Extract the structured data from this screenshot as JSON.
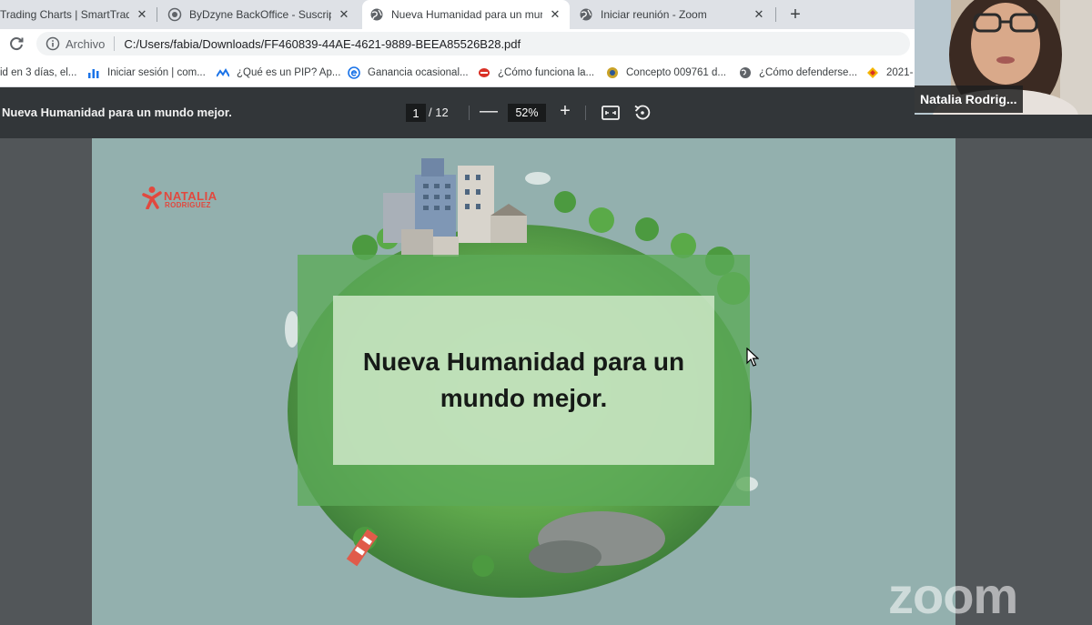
{
  "tabs": [
    {
      "title": "Trading Charts | SmartTrader",
      "icon": "trading-icon",
      "active": false
    },
    {
      "title": "ByDzyne BackOffice - Suscripción",
      "icon": "bydzyne-icon",
      "active": false
    },
    {
      "title": "Nueva Humanidad para un mundo mejor.",
      "icon": "globe-icon",
      "active": true
    },
    {
      "title": "Iniciar reunión - Zoom",
      "icon": "globe-icon",
      "active": false
    }
  ],
  "new_tab_label": "+",
  "close_glyph": "✕",
  "address": {
    "scheme_label": "Archivo",
    "url": "C:/Users/fabia/Downloads/FF460839-44AE-4621-9889-BEEA85526B28.pdf"
  },
  "bookmarks": [
    {
      "label": "id en 3 días, el...",
      "icon": ""
    },
    {
      "label": "Iniciar sesión | com...",
      "icon": "chart-icon"
    },
    {
      "label": "¿Qué es un PIP? Ap...",
      "icon": "mountain-icon"
    },
    {
      "label": "Ganancia ocasional...",
      "icon": "e-icon"
    },
    {
      "label": "¿Cómo funciona la...",
      "icon": "red-icon"
    },
    {
      "label": "Concepto 009761 d...",
      "icon": "seal-icon"
    },
    {
      "label": "¿Cómo defenderse...",
      "icon": "globe-icon"
    },
    {
      "label": "2021-",
      "icon": "diamond-icon"
    }
  ],
  "pdf": {
    "title": "Nueva Humanidad para un mundo mejor.",
    "current_page": "1",
    "total_pages": "/ 12",
    "zoom_minus": "—",
    "zoom": "52%",
    "zoom_plus": "+"
  },
  "slide": {
    "logo_top": "NATALIA",
    "logo_bottom": "RODRIGUEZ",
    "title": "Nueva Humanidad para un mundo mejor."
  },
  "participant": {
    "name": "Natalia Rodrig..."
  },
  "watermark": "zoom",
  "colors": {
    "tabstrip": "#dee1e6",
    "pdf_toolbar": "#323639",
    "slide_background": "#93b0ae",
    "slide_green": "#5caa58",
    "logo_red": "#e2483e"
  }
}
